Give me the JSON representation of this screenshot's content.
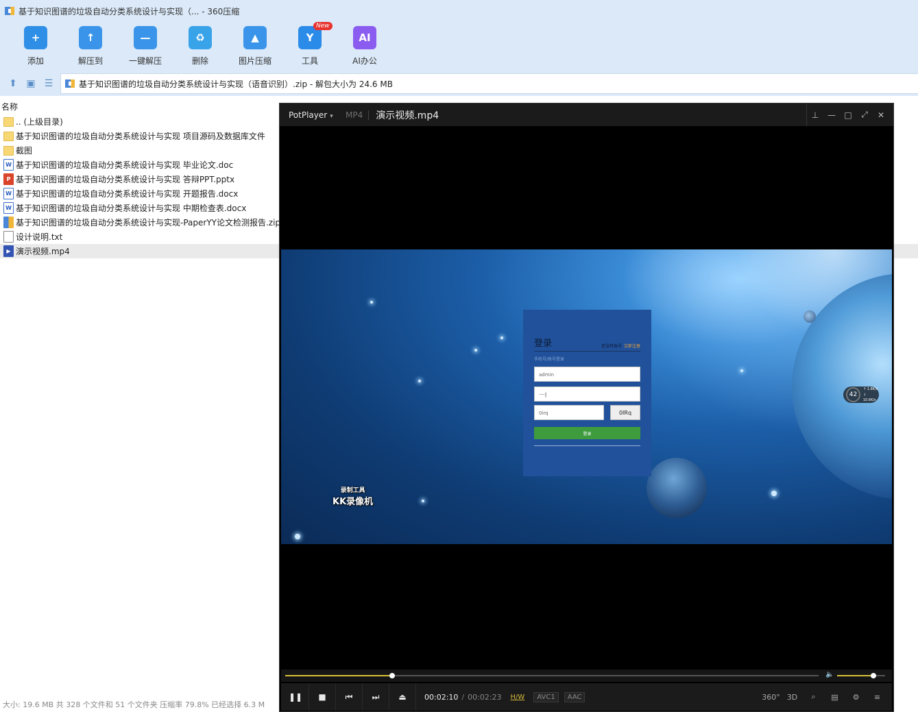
{
  "zip": {
    "title": "基于知识图谱的垃圾自动分类系统设计与实现（... - 360压缩",
    "toolbar": [
      {
        "label": "添加",
        "icon": "add-icon",
        "color": "#2f8fe6",
        "glyph": "+"
      },
      {
        "label": "解压到",
        "icon": "extract-to-icon",
        "color": "#3a95ea",
        "glyph": "↑"
      },
      {
        "label": "一键解压",
        "icon": "one-click-extract-icon",
        "color": "#3a95ea",
        "glyph": "—"
      },
      {
        "label": "删除",
        "icon": "delete-icon",
        "color": "#39a3ea",
        "glyph": "♻"
      },
      {
        "label": "图片压缩",
        "icon": "image-compress-icon",
        "color": "#3a95ea",
        "glyph": "▲"
      },
      {
        "label": "工具",
        "icon": "tools-icon",
        "color": "#2b8be8",
        "glyph": "Y",
        "badge": "New"
      },
      {
        "label": "AI办公",
        "icon": "ai-office-icon",
        "color": "#8a5cf0",
        "glyph": "AI"
      }
    ],
    "path": "基于知识图谱的垃圾自动分类系统设计与实现（语音识别）.zip - 解包大小为 24.6 MB",
    "column_name": "名称",
    "files": [
      {
        "name": ".. (上级目录)",
        "type": "folder"
      },
      {
        "name": "基于知识图谱的垃圾自动分类系统设计与实现 项目源码及数据库文件",
        "type": "folder"
      },
      {
        "name": "截图",
        "type": "folder"
      },
      {
        "name": "基于知识图谱的垃圾自动分类系统设计与实现 毕业论文.doc",
        "type": "doc"
      },
      {
        "name": "基于知识图谱的垃圾自动分类系统设计与实现 答辩PPT.pptx",
        "type": "ppt"
      },
      {
        "name": "基于知识图谱的垃圾自动分类系统设计与实现 开题报告.docx",
        "type": "doc"
      },
      {
        "name": "基于知识图谱的垃圾自动分类系统设计与实现 中期检查表.docx",
        "type": "doc"
      },
      {
        "name": "基于知识图谱的垃圾自动分类系统设计与实现-PaperYY论文检测报告.zip",
        "type": "zip"
      },
      {
        "name": "设计说明.txt",
        "type": "txt"
      },
      {
        "name": "演示视频.mp4",
        "type": "mp4",
        "selected": true
      }
    ],
    "status": "大小: 19.6 MB 共 328 个文件和 51 个文件夹 压缩率 79.8% 已经选择 6.3 M"
  },
  "player": {
    "brand": "PotPlayer",
    "format": "MP4",
    "filename": "演示视频.mp4",
    "current_time": "00:02:10",
    "duration": "00:02:23",
    "hw_tag": "H/W",
    "video_codec": "AVC1",
    "audio_codec": "AAC",
    "progress": 0.2,
    "volume": 0.75,
    "right_buttons": [
      "360°",
      "3D"
    ],
    "video_frame": {
      "login_title": "登录",
      "no_account": "还没有账号",
      "register": "立即注册",
      "subtitle": "手机号/账号登录",
      "username": "admin",
      "password": "····|",
      "captcha_input": "0irq",
      "captcha_image": "0IRq",
      "login_button": "登录",
      "watermark_line1": "录制工具",
      "watermark_line2": "KK录像机",
      "widget_percent": "42",
      "widget_up": "↑ 1.8K/s",
      "widget_down": "↓ 10.6K/s"
    }
  }
}
